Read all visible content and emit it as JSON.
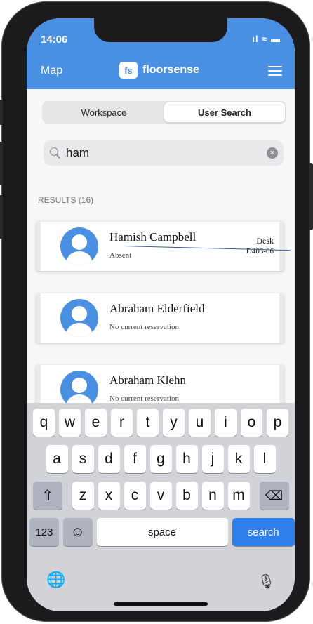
{
  "status": {
    "time": "14:06",
    "icons": "ıl ≈ ▬"
  },
  "header": {
    "left_label": "Map",
    "logo_badge": "fs",
    "logo_text": "floorsense"
  },
  "segments": [
    {
      "label": "Workspace",
      "active": false
    },
    {
      "label": "User Search",
      "active": true
    }
  ],
  "search": {
    "value": "ham",
    "placeholder": "",
    "clear_glyph": "×"
  },
  "results": {
    "label": "RESULTS (16)",
    "items": [
      {
        "name": "Hamish Campbell",
        "status": "Absent",
        "type": "Desk",
        "desk": "D403-06"
      },
      {
        "name": "Abraham Elderfield",
        "status": "No current reservation",
        "type": "",
        "desk": ""
      },
      {
        "name": "Abraham Klehn",
        "status": "No current reservation",
        "type": "",
        "desk": ""
      }
    ]
  },
  "keyboard": {
    "row1": [
      "q",
      "w",
      "e",
      "r",
      "t",
      "y",
      "u",
      "i",
      "o",
      "p"
    ],
    "row2": [
      "a",
      "s",
      "d",
      "f",
      "g",
      "h",
      "j",
      "k",
      "l"
    ],
    "row3": [
      "z",
      "x",
      "c",
      "v",
      "b",
      "n",
      "m"
    ],
    "shift": "⇧",
    "backspace": "⌫",
    "numbers": "123",
    "emoji": "☺",
    "space": "space",
    "search": "search",
    "globe": "🌐",
    "mic": "🎙"
  }
}
